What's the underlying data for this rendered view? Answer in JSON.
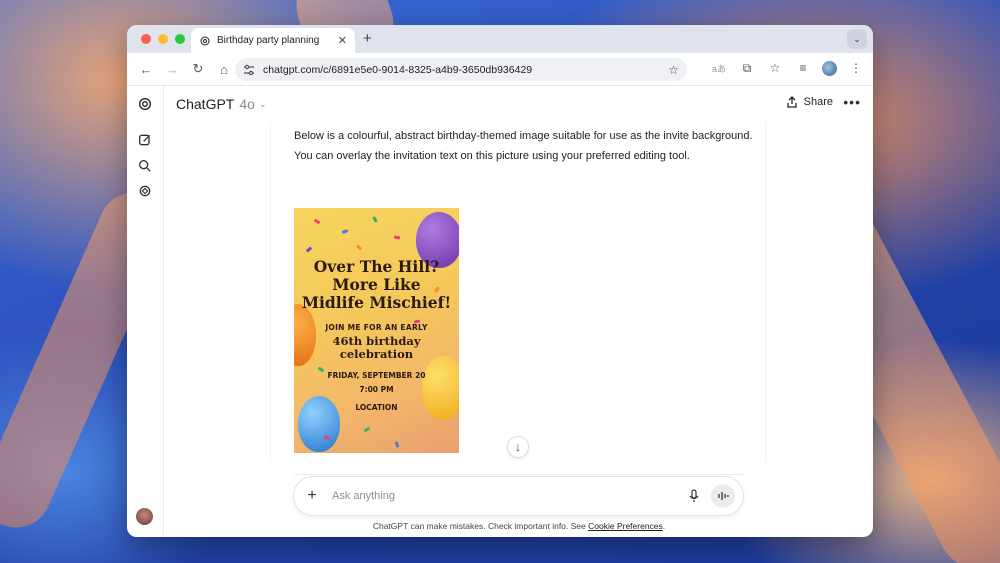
{
  "browser": {
    "tab_title": "Birthday party planning",
    "url": "chatgpt.com/c/6891e5e0-9014-8325-a4b9-3650db936429"
  },
  "app": {
    "name": "ChatGPT",
    "model": "4o",
    "share_label": "Share"
  },
  "message": {
    "text": "Below is a colourful, abstract birthday-themed image suitable for use as the invite background. You can overlay the invitation text on this picture using your preferred editing tool."
  },
  "invite": {
    "headline_1": "Over The Hill?",
    "headline_2": "More Like",
    "headline_3": "Midlife Mischief!",
    "join": "JOIN ME FOR AN EARLY",
    "celebration_1": "46th birthday",
    "celebration_2": "celebration",
    "date": "FRIDAY, SEPTEMBER 20",
    "time": "7:00 PM",
    "location": "LOCATION"
  },
  "composer": {
    "placeholder": "Ask anything"
  },
  "footer": {
    "disclaimer": "ChatGPT can make mistakes. Check important info. See ",
    "link": "Cookie Preferences",
    "end": "."
  },
  "colors": {
    "window_bg": "#ffffff",
    "tabbar_bg": "#dfe3eb",
    "invite_bg": "#f5c95b"
  },
  "icons": [
    "openai-logo-icon",
    "new-chat-icon",
    "search-icon",
    "library-icon",
    "share-icon",
    "more-icon",
    "plus-icon",
    "mic-icon",
    "voice-mode-icon",
    "arrow-down-icon"
  ]
}
